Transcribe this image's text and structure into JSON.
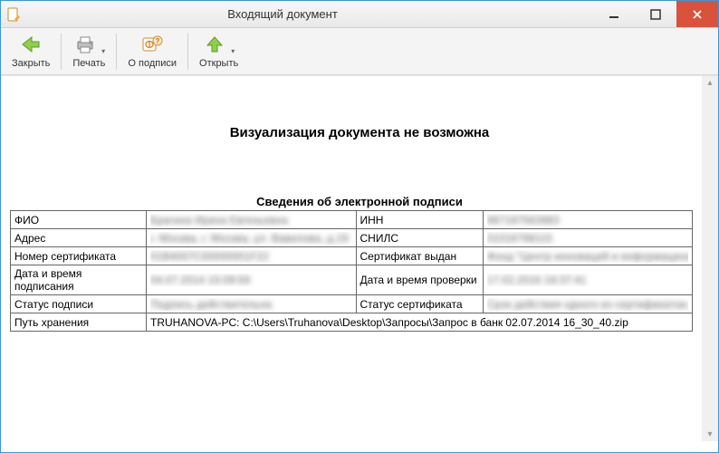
{
  "window": {
    "title": "Входящий документ"
  },
  "toolbar": {
    "close": "Закрыть",
    "print": "Печать",
    "about_sign": "О подписи",
    "open": "Открыть"
  },
  "headings": {
    "main": "Визуализация документа не возможна",
    "section": "Сведения об электронной подписи"
  },
  "labels": {
    "fio": "ФИО",
    "inn": "ИНН",
    "address": "Адрес",
    "snils": "СНИЛС",
    "cert_no": "Номер сертификата",
    "cert_issued": "Сертификат выдан",
    "sign_datetime": "Дата и время подписания",
    "check_datetime": "Дата и время проверки",
    "sign_status": "Статус подписи",
    "cert_status": "Статус сертификата",
    "storage_path": "Путь хранения"
  },
  "values": {
    "fio": "Брагина Ирина Евгеньевна",
    "inn": "987187563983",
    "address": "г. Москва, г. Москва, ул. Вавилова, д.19",
    "snils": "01016798115",
    "cert_no": "01B4007C00000001F22",
    "cert_issued": "Фонд \"Центр инноваций и информационных технологий\"",
    "sign_datetime": "04.07.2014 15:09:59",
    "check_datetime": "17.02.2016 18:37:41",
    "sign_status": "Подпись действительна",
    "cert_status": "Срок действия одного из сертификатов цепочки истек или еще не наступил.",
    "storage_path": "TRUHANOVA-PC: C:\\Users\\Truhanova\\Desktop\\Запросы\\Запрос в банк 02.07.2014 16_30_40.zip"
  }
}
